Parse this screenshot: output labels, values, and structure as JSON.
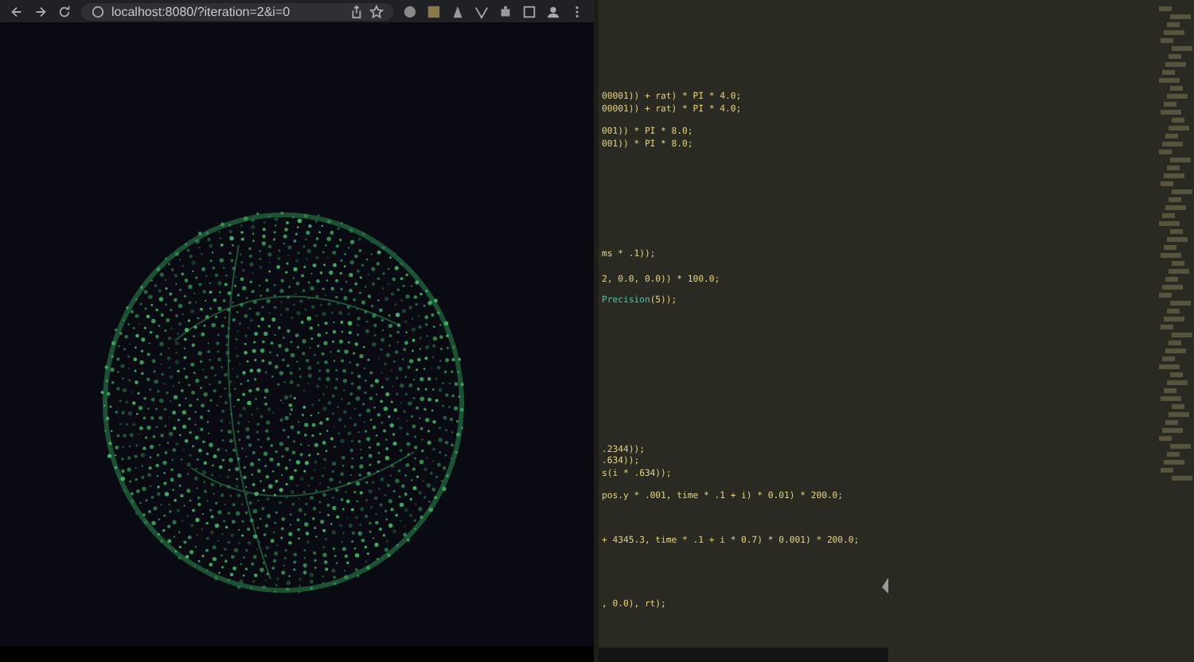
{
  "browser": {
    "url": "localhost:8080/?iteration=2&i=0"
  },
  "editor": {
    "blocks": [
      {
        "lines": [
          [
            {
              "kind": "plain",
              "text": "00001)) + rat) * PI * 4.0;"
            }
          ],
          [
            {
              "kind": "plain",
              "text": "00001)) + rat) * PI * 4.0;"
            }
          ]
        ]
      },
      {
        "lines": [
          [
            {
              "kind": "plain",
              "text": "001)) * PI * 8.0;"
            }
          ],
          [
            {
              "kind": "plain",
              "text": "001)) * PI * 8.0;"
            }
          ]
        ]
      },
      {
        "lines": [
          [
            {
              "kind": "plain",
              "text": "ms * .1));"
            }
          ]
        ]
      },
      {
        "lines": [
          [
            {
              "kind": "plain",
              "text": "2, 0.0, 0.0)) * 100.0;"
            }
          ]
        ]
      },
      {
        "lines": [
          [
            {
              "kind": "function",
              "text": "Precision"
            },
            {
              "kind": "plain",
              "text": "(5));"
            }
          ]
        ]
      },
      {
        "lines": [
          [
            {
              "kind": "plain",
              "text": ".2344));"
            }
          ],
          [
            {
              "kind": "plain",
              "text": ".634));"
            }
          ],
          [
            {
              "kind": "plain",
              "text": "s(i * .634));"
            }
          ]
        ]
      },
      {
        "lines": [
          [
            {
              "kind": "plain",
              "text": "pos.y * .001, time * .1 + i) * 0.01) * 200.0;"
            }
          ]
        ]
      },
      {
        "lines": [
          [
            {
              "kind": "plain",
              "text": "+ 4345.3, time * .1 + i * 0.7) * 0.001) * 200.0;"
            }
          ]
        ]
      },
      {
        "lines": [
          [
            {
              "kind": "plain",
              "text": ", 0.0), rt);"
            }
          ]
        ]
      }
    ]
  }
}
